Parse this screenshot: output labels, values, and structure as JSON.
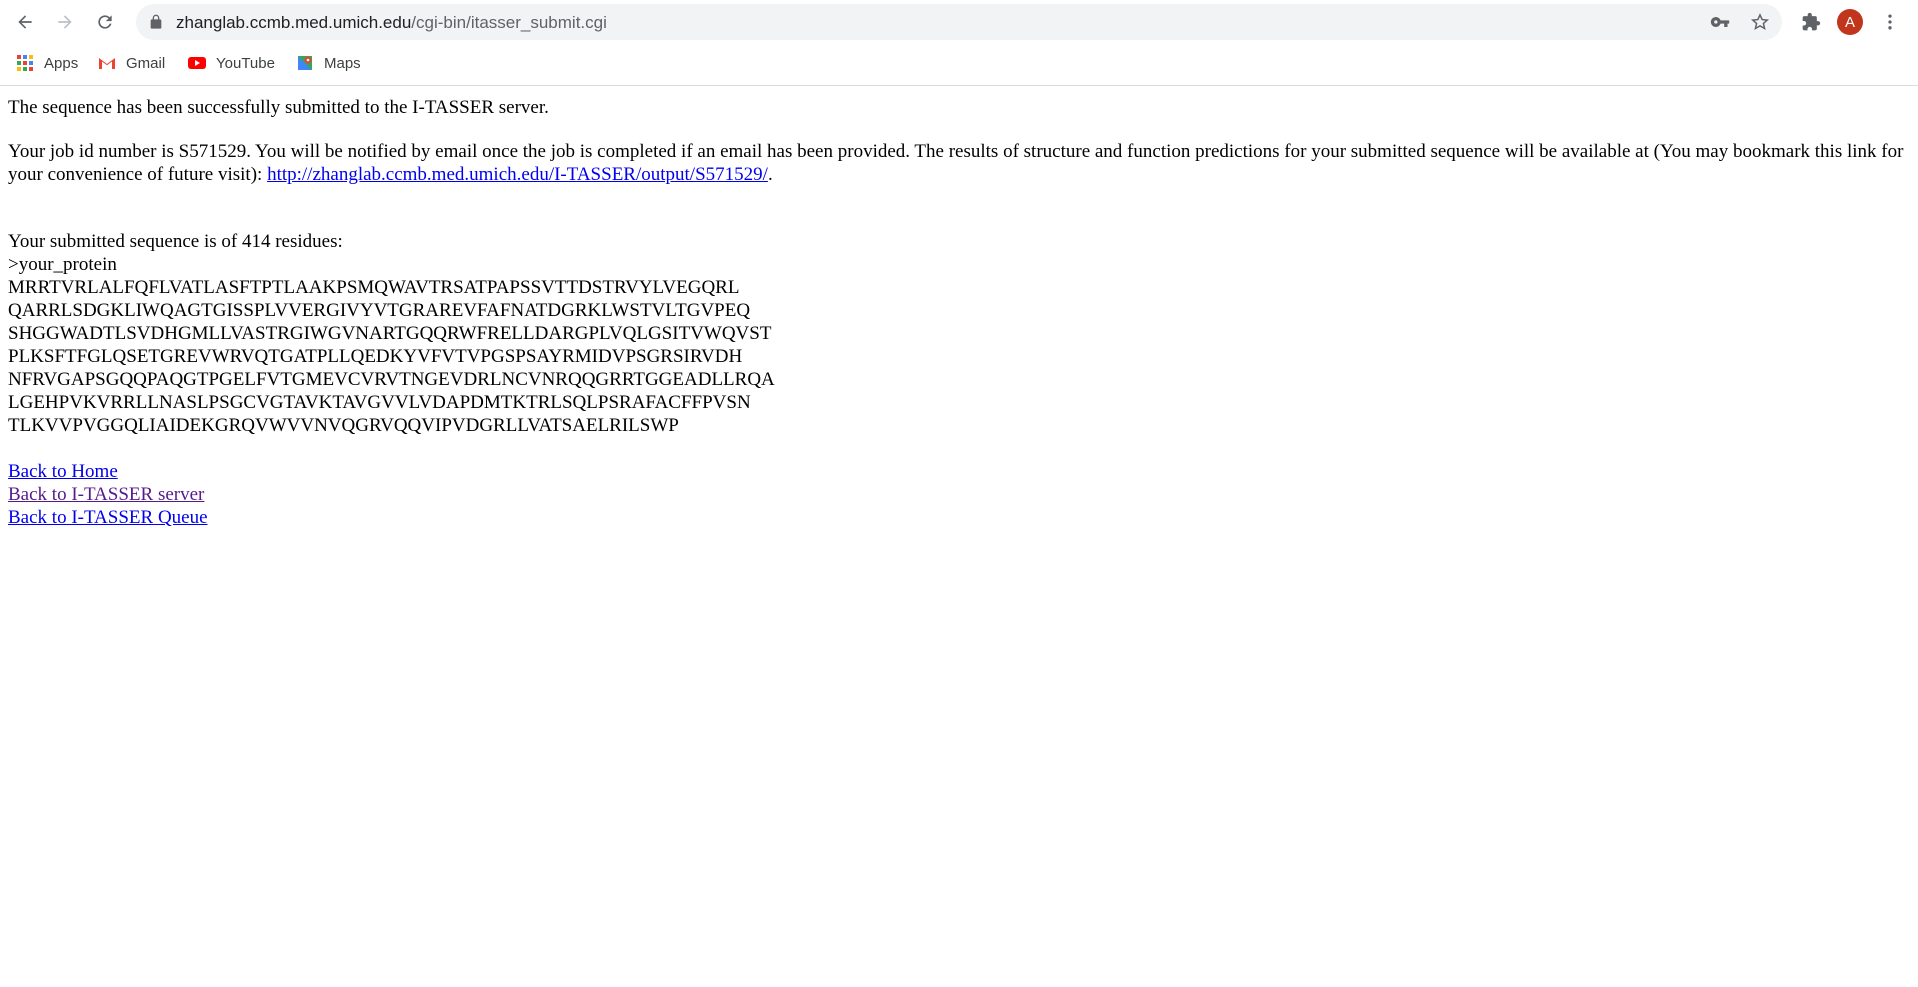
{
  "browser": {
    "url_domain": "zhanglab.ccmb.med.umich.edu",
    "url_path": "/cgi-bin/itasser_submit.cgi",
    "avatar_letter": "A",
    "bookmarks": [
      {
        "label": "Apps",
        "icon": "apps-grid-icon"
      },
      {
        "label": "Gmail",
        "icon": "gmail-icon"
      },
      {
        "label": "YouTube",
        "icon": "youtube-icon"
      },
      {
        "label": "Maps",
        "icon": "maps-icon"
      }
    ]
  },
  "page": {
    "success_message": "The sequence has been successfully submitted to the I-TASSER server.",
    "job_text": "Your job id number is S571529. You will be notified by email once the job is completed if an email has been provided. The results of structure and function predictions for your submitted sequence will be available at (You may bookmark this link for your convenience of future visit): ",
    "result_link": "http://zhanglab.ccmb.med.umich.edu/I-TASSER/output/S571529/",
    "result_link_suffix": ".",
    "residue_text": "Your submitted sequence is of 414 residues:",
    "seq_header": ">your_protein",
    "sequence_lines": [
      "MRRTVRLALFQFLVATLASFTPTLAAKPSMQWAVTRSATPAPSSVTTDSTRVYLVEGQRL",
      "QARRLSDGKLIWQAGTGISSPLVVERGIVYVTGRAREVFAFNATDGRKLWSTVLTGVPEQ",
      "SHGGWADTLSVDHGMLLVASTRGIWGVNARTGQQRWFRELLDARGPLVQLGSITVWQVST",
      "PLKSFTFGLQSETGREVWRVQTGATPLLQEDKYVFVTVPGSPSAYRMIDVPSGRSIRVDH",
      "NFRVGAPSGQQPAQGTPGELFVTGMEVCVRVTNGEVDRLNCVNRQQGRRTGGEADLLRQA",
      "LGEHPVKVRRLLNASLPSGCVGTAVKTAVGVVLVDAPDMTKTRLSQLPSRAFACFFPVSN",
      "TLKVVPVGGQLIAIDEKGRQVWVVNVQGRVQQVIPVDGRLLVATSAELRILSWP"
    ],
    "links": {
      "home": "Back to Home",
      "server": "Back to I-TASSER server",
      "queue": "Back to I-TASSER Queue"
    }
  }
}
